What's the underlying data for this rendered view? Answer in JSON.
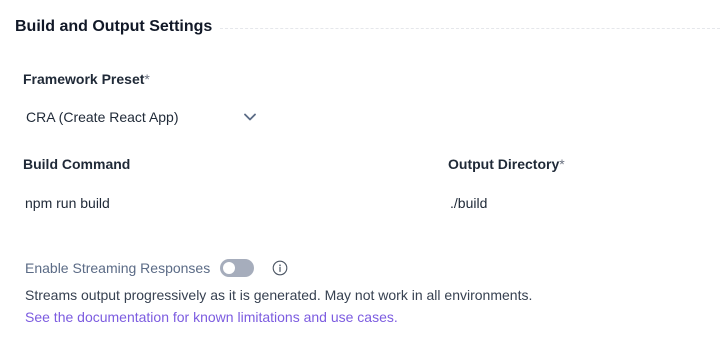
{
  "section": {
    "title": "Build and Output Settings"
  },
  "framework": {
    "label": "Framework Preset",
    "required_mark": "*",
    "selected": "CRA (Create React App)",
    "icon": "chevron-down-icon"
  },
  "build_command": {
    "label": "Build Command",
    "value": "npm run build"
  },
  "output_directory": {
    "label": "Output Directory",
    "required_mark": "*",
    "value": "./build"
  },
  "streaming": {
    "label": "Enable Streaming Responses",
    "enabled": false,
    "info_icon": "info-icon",
    "description": "Streams output progressively as it is generated. May not work in all environments.",
    "link_text": "See the documentation for known limitations and use cases."
  },
  "colors": {
    "link": "#7c5ce0",
    "toggle_off": "#a6adbc",
    "label_muted": "#5b6b86"
  }
}
